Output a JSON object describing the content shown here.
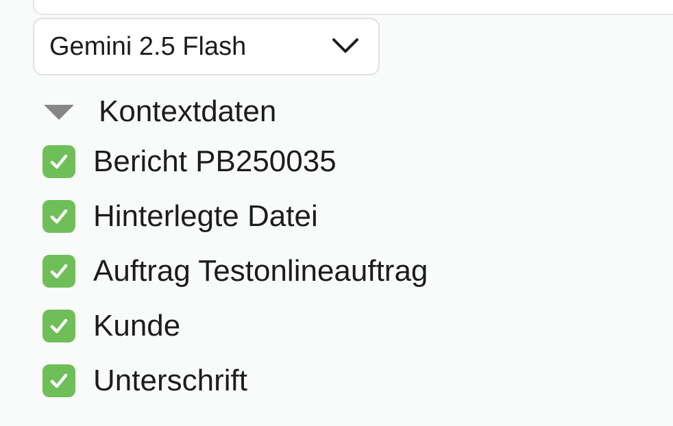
{
  "model_select": {
    "selected": "Gemini 2.5 Flash",
    "icon": "chevron-down-icon"
  },
  "context_section": {
    "title": "Kontextdaten",
    "expanded": true,
    "icon": "disclosure-triangle-icon",
    "check_color": "#6fbf58",
    "items": [
      {
        "label": "Bericht PB250035",
        "checked": true
      },
      {
        "label": "Hinterlegte Datei",
        "checked": true
      },
      {
        "label": "Auftrag Testonlineauftrag",
        "checked": true
      },
      {
        "label": "Kunde",
        "checked": true
      },
      {
        "label": "Unterschrift",
        "checked": true
      }
    ]
  }
}
